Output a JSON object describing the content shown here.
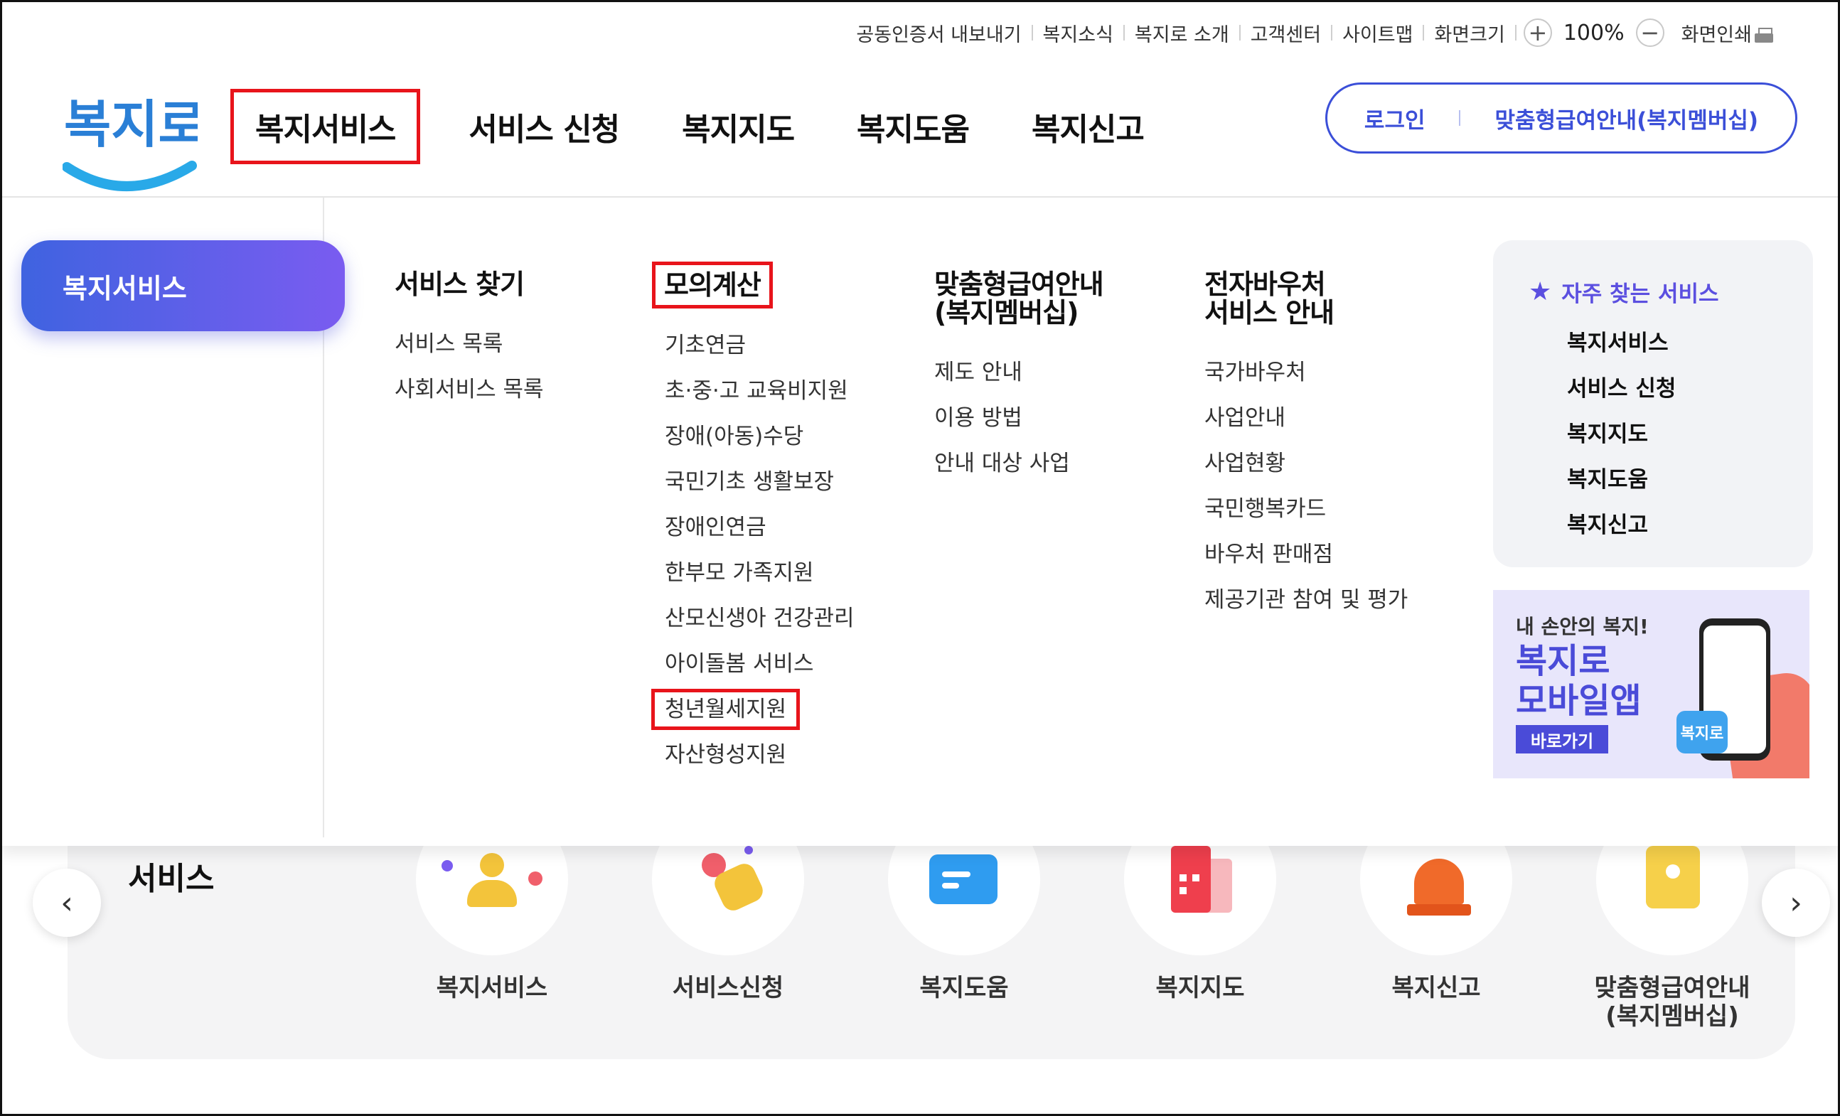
{
  "utility": {
    "items": [
      "공동인증서 내보내기",
      "복지소식",
      "복지로 소개",
      "고객센터",
      "사이트맵",
      "화면크기"
    ],
    "zoom_in": "+",
    "zoom_value": "100%",
    "zoom_out": "−",
    "print": "화면인쇄"
  },
  "logo": {
    "text": "복지로"
  },
  "gnb": [
    "복지서비스",
    "서비스 신청",
    "복지지도",
    "복지도움",
    "복지신고"
  ],
  "auth": {
    "login": "로그인",
    "membership": "맞춤형급여안내(복지멤버십)"
  },
  "mega": {
    "side_label": "복지서비스",
    "columns": [
      {
        "title": "서비스 찾기",
        "items": [
          "서비스 목록",
          "사회서비스 목록"
        ]
      },
      {
        "title": "모의계산",
        "items": [
          "기초연금",
          "초·중·고 교육비지원",
          "장애(아동)수당",
          "국민기초 생활보장",
          "장애인연금",
          "한부모 가족지원",
          "산모신생아 건강관리",
          "아이돌봄 서비스",
          "청년월세지원",
          "자산형성지원"
        ]
      },
      {
        "title_line1": "맞춤형급여안내",
        "title_line2": "(복지멤버십)",
        "items": [
          "제도 안내",
          "이용 방법",
          "안내 대상 사업"
        ]
      },
      {
        "title_line1": "전자바우처",
        "title_line2": "서비스 안내",
        "items": [
          "국가바우처",
          "사업안내",
          "사업현황",
          "국민행복카드",
          "바우처 판매점",
          "제공기관 참여 및 평가"
        ]
      }
    ],
    "favorites": {
      "title": "자주 찾는 서비스",
      "items": [
        "복지서비스",
        "서비스 신청",
        "복지지도",
        "복지도움",
        "복지신고"
      ]
    },
    "banner": {
      "line1": "내 손안의 복지!",
      "line2": "복지로",
      "line3": "모바일앱",
      "button": "바로가기",
      "mini_logo": "복지로"
    }
  },
  "quick": {
    "title": "서비스",
    "items": [
      "복지서비스",
      "서비스신청",
      "복지도움",
      "복지지도",
      "복지신고"
    ],
    "last_line1": "맞춤형급여안내",
    "last_line2": "(복지멤버십)",
    "prev": "‹",
    "next": "›"
  },
  "colors": {
    "accent": "#3b4fd8",
    "highlight": "#e8141b",
    "pill_start": "#3f63e0",
    "pill_end": "#7a5cf0"
  }
}
